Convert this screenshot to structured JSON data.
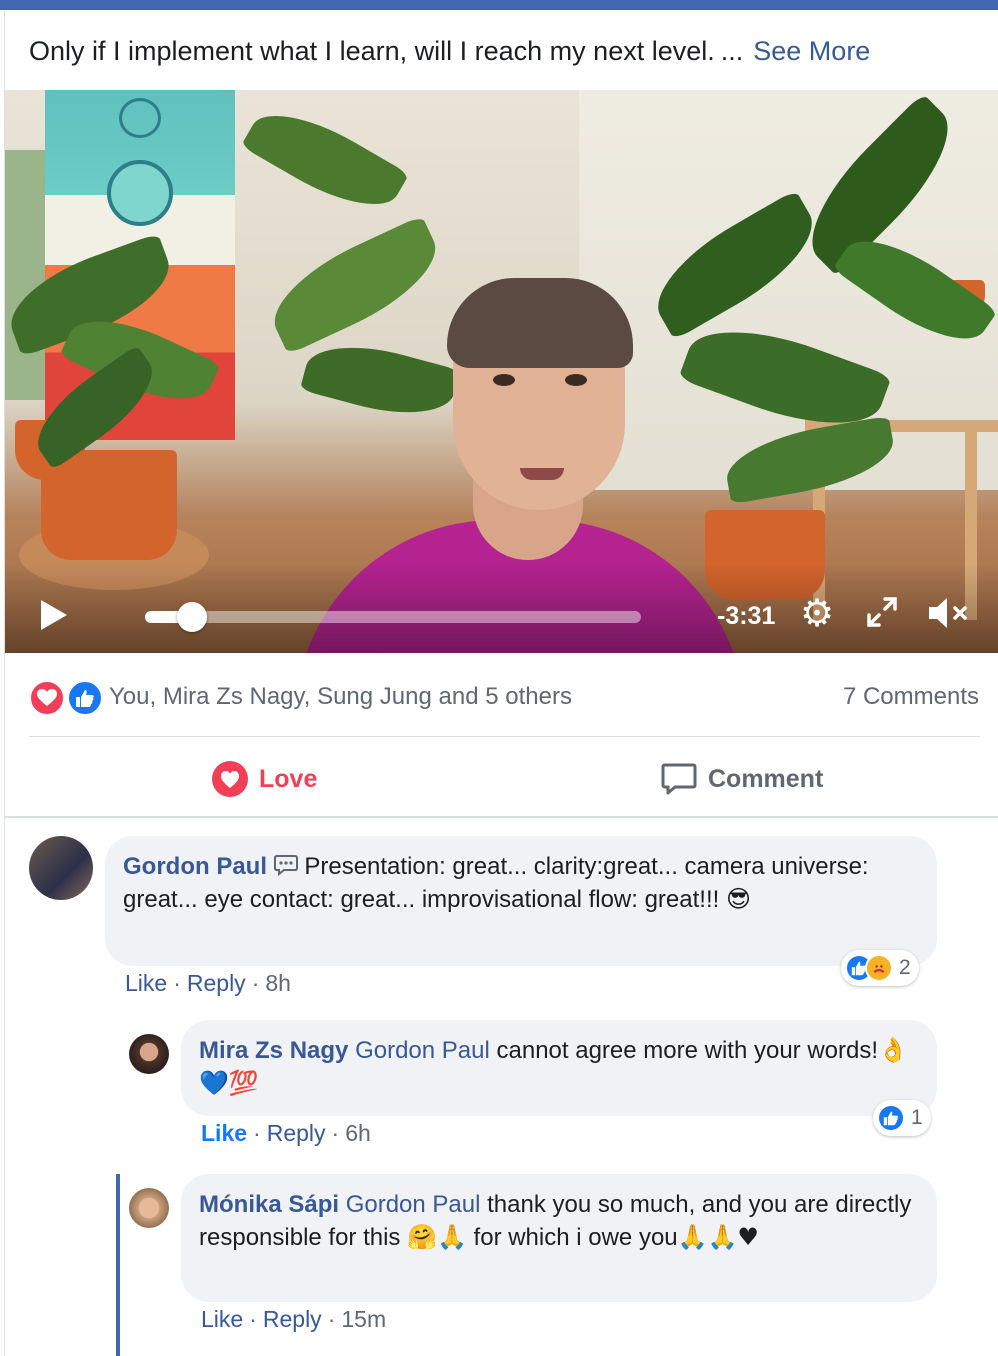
{
  "post": {
    "text": "Only if I implement what I learn, will I reach my next level.",
    "ellipsis": "...",
    "see_more": "See More"
  },
  "video": {
    "time_remaining": "-3:31",
    "progress_fraction": 0.05,
    "icons": [
      "play-icon",
      "settings-gear-icon",
      "fullscreen-icon",
      "muted-speaker-icon"
    ]
  },
  "reactions": {
    "names": "You, Mira Zs Nagy, Sung Jung and 5 others",
    "comment_count": "7 Comments",
    "icons": [
      "love-reaction-icon",
      "like-reaction-icon"
    ]
  },
  "actions": {
    "love_label": "Love",
    "comment_label": "Comment"
  },
  "comments": [
    {
      "author": "Gordon Paul",
      "badge_icon": "speech-bubble-icon",
      "text": "Presentation: great... clarity:great... camera universe: great... eye contact: great... improvisational flow: great!!!",
      "emoji": "😎",
      "like": "Like",
      "reply": "Reply",
      "time": "8h",
      "reaction_count": "2"
    },
    {
      "author": "Mira Zs Nagy",
      "mention": "Gordon Paul",
      "text": "cannot agree more with your words!",
      "emoji": "👌💙💯",
      "like": "Like",
      "reply": "Reply",
      "time": "6h",
      "reaction_count": "1"
    },
    {
      "author": "Mónika Sápi",
      "mention": "Gordon Paul",
      "text1": "thank you so much, and you are directly responsible for this",
      "emoji1": "🤗🙏",
      "text2": "for which i owe you",
      "emoji2": "🙏🙏♥",
      "like": "Like",
      "reply": "Reply",
      "time": "15m"
    }
  ],
  "colors": {
    "link": "#385898",
    "love": "#f33e58",
    "like_blue": "#1877f2",
    "bubble": "#f0f2f5",
    "meta_gray": "#606770"
  }
}
